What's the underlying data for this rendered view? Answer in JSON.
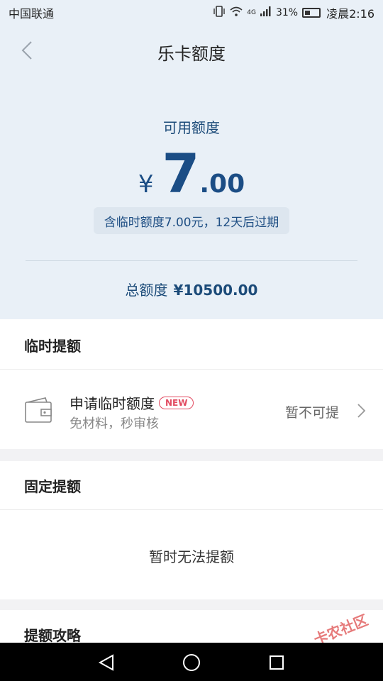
{
  "status_bar": {
    "carrier": "中国联通",
    "network_label": "4G",
    "battery": "31%",
    "time": "凌晨2:16"
  },
  "header": {
    "title": "乐卡额度",
    "back_icon": "chevron-left-icon"
  },
  "credit": {
    "available_label": "可用额度",
    "currency": "¥",
    "amount_int": "7",
    "amount_dec": ".00",
    "temp_note": "含临时额度7.00元，12天后过期",
    "total_label": "总额度",
    "total_value": "¥10500.00"
  },
  "temp_raise": {
    "title": "临时提额",
    "item_title": "申请临时额度",
    "badge": "NEW",
    "subtitle": "免材料，秒审核",
    "status": "暂不可提",
    "icon": "wallet-icon"
  },
  "fixed_raise": {
    "title": "固定提额",
    "message": "暂时无法提额"
  },
  "tips": {
    "title": "提额攻略"
  },
  "watermark": "卡农社区",
  "colors": {
    "hero_bg": "#e9f0f7",
    "accent_blue": "#1b4d85",
    "badge_red": "#e24b61"
  }
}
